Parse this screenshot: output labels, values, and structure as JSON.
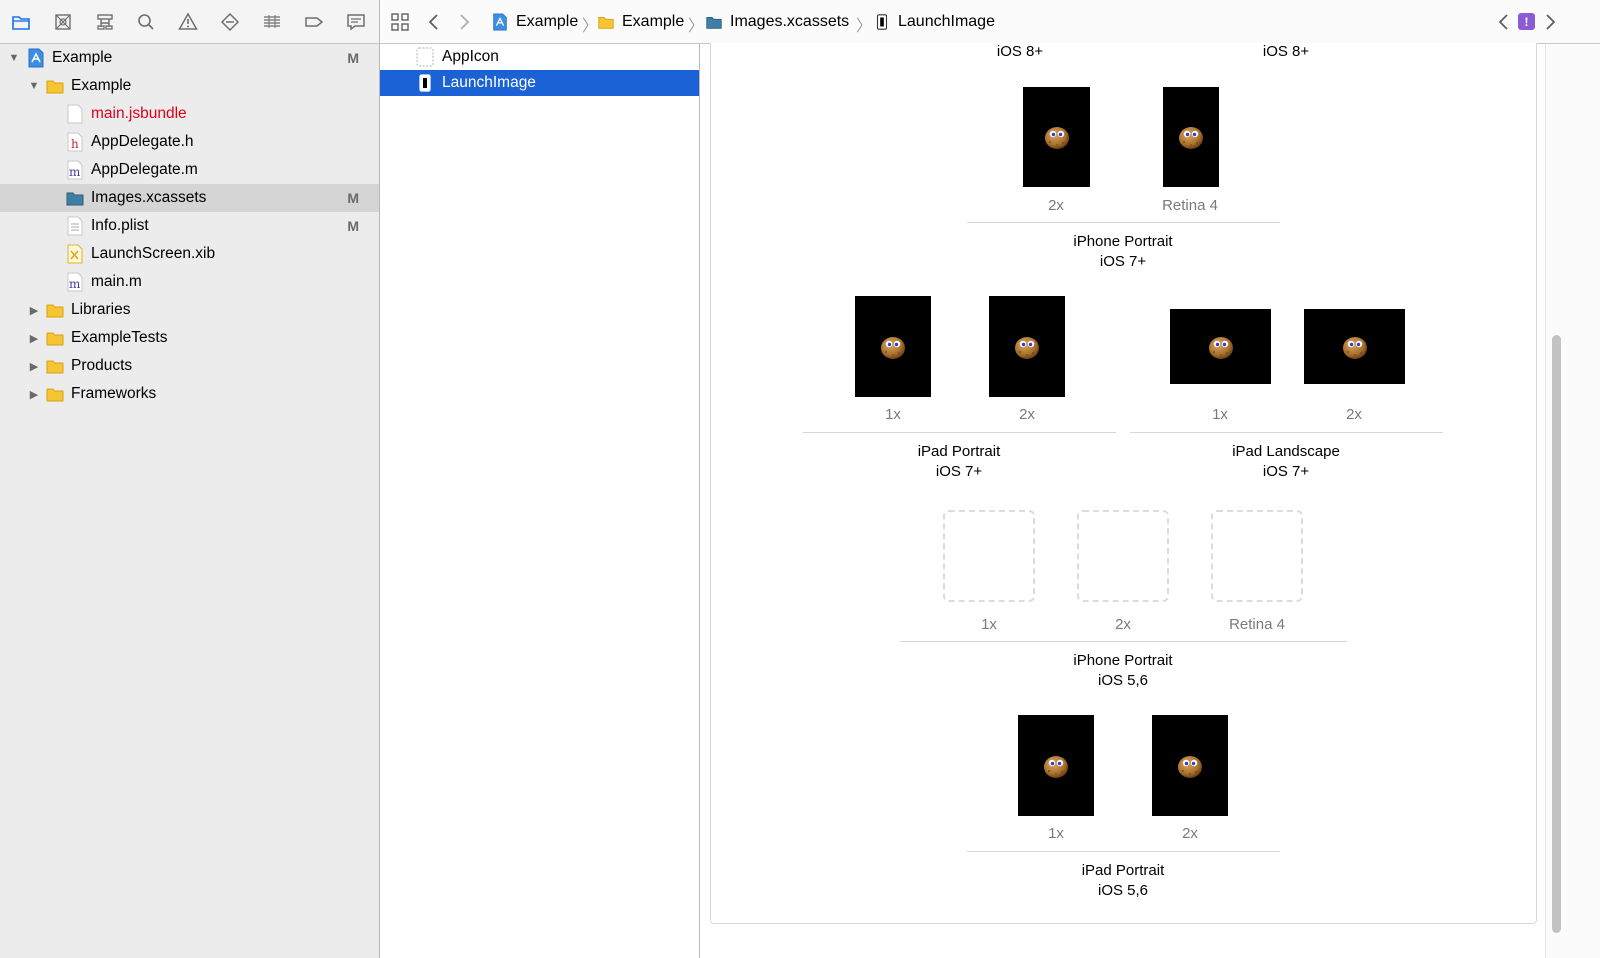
{
  "navigator": {
    "toolbar_icons": [
      "folder-icon",
      "source-control-icon",
      "hierarchy-icon",
      "search-icon",
      "warning-icon",
      "breakpoint-test-icon",
      "debug-icon",
      "tag-icon",
      "report-icon"
    ],
    "tree": [
      {
        "label": "Example",
        "badge": "M",
        "type": "project",
        "expanded": true
      },
      {
        "label": "Example",
        "badge": "",
        "type": "folder",
        "expanded": true
      },
      {
        "label": "main.jsbundle",
        "badge": "",
        "type": "file",
        "missing": true
      },
      {
        "label": "AppDelegate.h",
        "badge": "",
        "type": "h-file"
      },
      {
        "label": "AppDelegate.m",
        "badge": "",
        "type": "m-file"
      },
      {
        "label": "Images.xcassets",
        "badge": "M",
        "type": "xcassets",
        "selected": true
      },
      {
        "label": "Info.plist",
        "badge": "M",
        "type": "plist"
      },
      {
        "label": "LaunchScreen.xib",
        "badge": "",
        "type": "xib"
      },
      {
        "label": "main.m",
        "badge": "",
        "type": "m-file"
      },
      {
        "label": "Libraries",
        "badge": "",
        "type": "folder",
        "expanded": false
      },
      {
        "label": "ExampleTests",
        "badge": "",
        "type": "folder",
        "expanded": false
      },
      {
        "label": "Products",
        "badge": "",
        "type": "folder",
        "expanded": false
      },
      {
        "label": "Frameworks",
        "badge": "",
        "type": "folder",
        "expanded": false
      }
    ]
  },
  "jumpbar": {
    "crumbs": [
      "Example",
      "Example",
      "Images.xcassets",
      "LaunchImage"
    ],
    "issue_badge": "!"
  },
  "asset_list": [
    {
      "label": "AppIcon",
      "selected": false
    },
    {
      "label": "LaunchImage",
      "selected": true
    }
  ],
  "canvas": {
    "top_labels": [
      "iOS 8+",
      "iOS 8+"
    ],
    "groups": [
      {
        "slots": [
          {
            "label": "2x",
            "filled": true
          },
          {
            "label": "Retina 4",
            "filled": true
          }
        ],
        "title": [
          "iPhone Portrait",
          "iOS 7+"
        ]
      },
      {
        "slots": [
          {
            "label": "1x",
            "filled": true
          },
          {
            "label": "2x",
            "filled": true
          }
        ],
        "title": [
          "iPad Portrait",
          "iOS 7+"
        ]
      },
      {
        "slots": [
          {
            "label": "1x",
            "filled": true
          },
          {
            "label": "2x",
            "filled": true
          }
        ],
        "title": [
          "iPad Landscape",
          "iOS 7+"
        ]
      },
      {
        "slots": [
          {
            "label": "1x",
            "filled": false
          },
          {
            "label": "2x",
            "filled": false
          },
          {
            "label": "Retina 4",
            "filled": false
          }
        ],
        "title": [
          "iPhone Portrait",
          "iOS 5,6"
        ]
      },
      {
        "slots": [
          {
            "label": "1x",
            "filled": true
          },
          {
            "label": "2x",
            "filled": true
          }
        ],
        "title": [
          "iPad Portrait",
          "iOS 5,6"
        ]
      }
    ]
  },
  "colors": {
    "accent": "#1a62d6",
    "missing_file": "#e0001b",
    "issue": "#8c5bd6"
  }
}
